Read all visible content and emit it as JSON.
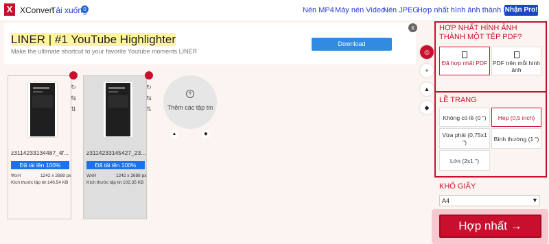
{
  "header": {
    "logo": "X",
    "app_name": "XConvert",
    "downloads_label": "Tải xuống",
    "downloads_count": "0",
    "nav": [
      "Nén MP4",
      "Máy nén Video",
      "Nén JPEG",
      "Hợp nhất hình ảnh thành PDF"
    ],
    "pro_label": "Nhận Pro!"
  },
  "ad": {
    "title_highlight": "LINER | #1 YouTube Highlighter",
    "subtitle": "Make the ultimate shortcut to your favorite Youtube moments LINER",
    "download_label": "Download",
    "close_symbol": "x"
  },
  "files": [
    {
      "name": "z3114233134487_4f...",
      "status": "Đã tải lên 100%",
      "dim_label": "WxH",
      "dims": "1242 x 2688 px",
      "size_label": "Kích thước tập tin",
      "size": "146,54 KB"
    },
    {
      "name": "z3114233145427_23...",
      "status": "Đã tải lên 100%",
      "dim_label": "WxH",
      "dims": "1242 x 2688 px",
      "size_label": "Kích thước tập tin",
      "size": "102,35 KB"
    }
  ],
  "add_files_label": "Thêm các tập tin",
  "card_controls": {
    "rotate": "↻",
    "swap_h": "⇆",
    "swap_v": "⇅"
  },
  "rail": {
    "target": "◎",
    "add": "+",
    "drive": "▲",
    "dropbox": "◆"
  },
  "sidebar": {
    "merge_title": "HỢP NHẤT HÌNH ẢNH THÀNH MỘT TỆP PDF?",
    "merge_options": [
      "Đã hợp nhất PDF",
      "PDF trên mỗi hình ảnh"
    ],
    "margin_title": "LỀ TRANG",
    "margin_options": [
      "Không có lề (0 \")",
      "Hẹp (0,5 inch)",
      "Vừa phải (0,75x1 \")",
      "Bình thường (1 \")",
      "Lớn (2x1 \")"
    ],
    "paper_title": "KHỔ GIẤY",
    "paper_value": "A4",
    "merge_button": "Hợp nhất →"
  },
  "colors": {
    "accent": "#c8102e",
    "link": "#2a3bd8",
    "progress": "#1a73e8"
  }
}
